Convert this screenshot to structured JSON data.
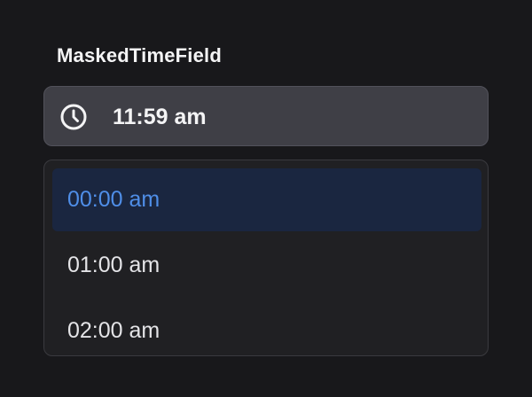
{
  "field": {
    "label": "MaskedTimeField",
    "value": "11:59 am",
    "icon": "clock-icon"
  },
  "dropdown": {
    "options": [
      {
        "label": "00:00 am",
        "selected": true
      },
      {
        "label": "01:00 am",
        "selected": false
      },
      {
        "label": "02:00 am",
        "selected": false
      }
    ]
  },
  "colors": {
    "background": "#18181b",
    "input_background": "#3f3f46",
    "dropdown_background": "#202023",
    "selected_background": "#1a2640",
    "selected_text": "#4f8ee8",
    "text": "#f4f4f5"
  }
}
